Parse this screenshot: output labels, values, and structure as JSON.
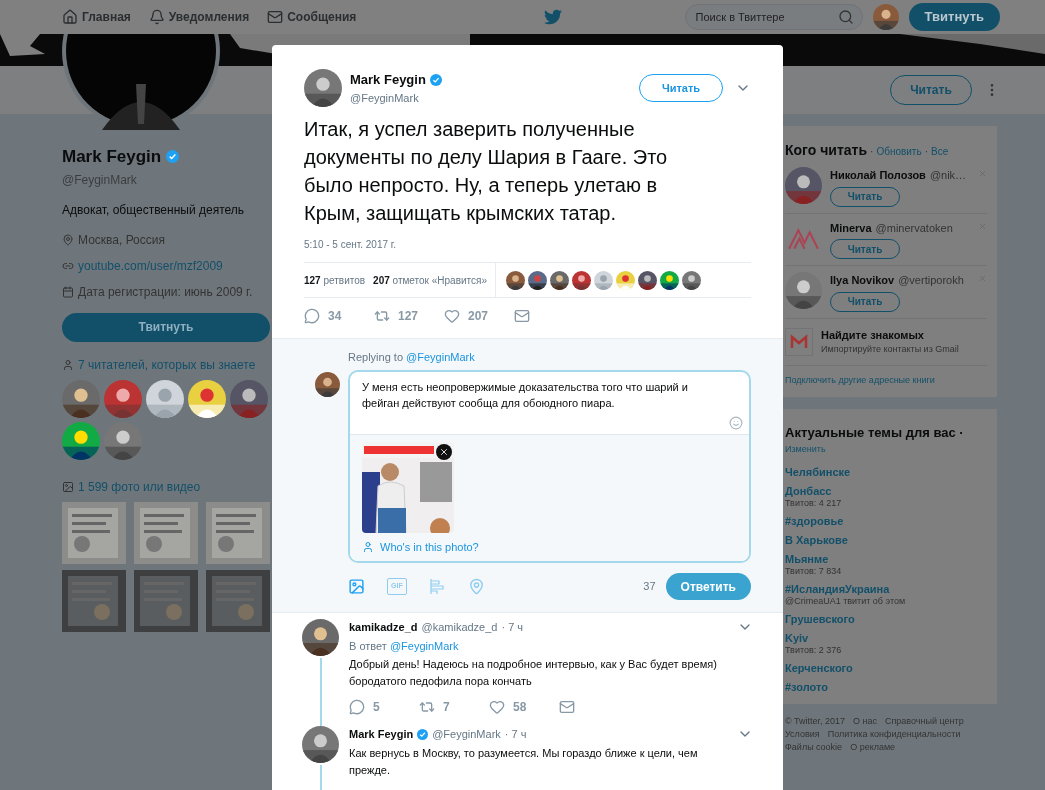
{
  "nav": {
    "items": [
      {
        "label": "Главная"
      },
      {
        "label": "Уведомления"
      },
      {
        "label": "Сообщения"
      }
    ],
    "search": {
      "placeholder": "Поиск в Твиттере"
    },
    "tweet_button": "Твитнуть"
  },
  "profile_bar": {
    "follow_button": "Читать"
  },
  "profile": {
    "name": "Mark Feygin",
    "verified": true,
    "handle": "@FeyginMark",
    "bio": "Адвокат, общественный деятель",
    "location": "Москва, Россия",
    "link": "youtube.com/user/mzf2009",
    "joined": "Дата регистрации: июнь 2009 г.",
    "tweet_button": "Твитнуть",
    "followers_known": "7 читателей, которых вы знаете",
    "media_label": "1 599 фото или видео"
  },
  "modal": {
    "author": {
      "name": "Mark Feygin",
      "verified": true,
      "handle": "@FeyginMark"
    },
    "follow_button": "Читать",
    "text": "Итак, я успел заверить полученные документы по делу Шария в Гааге. Это было непросто. Ну, а теперь улетаю в Крым, защищать крымских татар.",
    "time": "5:10 - 5 сент. 2017 г.",
    "stats": [
      "**127** ретвитов",
      "**207** отметок «Нравится»"
    ],
    "actions": {
      "replies": "34",
      "retweets": "127",
      "likes": "207"
    },
    "composer": {
      "replying_prefix": "Replying to",
      "replying_handle": "@FeyginMark",
      "value": "У меня есть неопровержимые доказательства того что шарий и фейган действуют сообща для обоюдного пиара.",
      "tag_link": "Who's in this photo?",
      "gif_label": "GIF",
      "counter": "37",
      "submit": "Ответить"
    },
    "replies": [
      {
        "name": "kamikadze_d",
        "verified": false,
        "handle": "@kamikadze_d",
        "time": "· 7 ч",
        "reply_prefix": "В ответ",
        "reply_handle": "@FeyginMark",
        "text": "Добрый день! Надеюсь на подробное интервью, как у Вас будет время)\nбородатого педофила пора кончать",
        "actions": {
          "replies": "5",
          "retweets": "7",
          "likes": "58"
        }
      },
      {
        "name": "Mark Feygin",
        "verified": true,
        "handle": "@FeyginMark",
        "time": "· 7 ч",
        "text": "Как вернусь в Москву, то разумеется. Мы гораздо ближе к цели, чем прежде."
      }
    ]
  },
  "who_to_follow": {
    "title": "Кого читать",
    "separator": "·",
    "links": [
      "Обновить",
      "Все"
    ],
    "suggestions": [
      {
        "name": "Николай Полозов",
        "handle": "@nik…",
        "button": "Читать",
        "kind": "person"
      },
      {
        "name": "Minerva",
        "handle": "@minervatoken",
        "button": "Читать",
        "kind": "logo"
      },
      {
        "name": "Ilya Novikov",
        "handle": "@vertiporokh",
        "button": "Читать",
        "kind": "person"
      }
    ],
    "find_friends": {
      "title": "Найдите знакомых",
      "subtitle": "Импортируйте контакты из Gmail"
    },
    "connect_link": "Подключить другие адресные книги"
  },
  "trends": {
    "title": "Актуальные темы для вас ·",
    "change_link": "Изменить",
    "items": [
      {
        "name": "Челябинске"
      },
      {
        "name": "Донбасс",
        "meta": "Твитов: 4 217"
      },
      {
        "name": "#здоровье"
      },
      {
        "name": "В Харькове"
      },
      {
        "name": "Мьянме",
        "meta": "Твитов: 7 834"
      },
      {
        "name": "#ИсландияУкраина",
        "meta": "@CrimeaUA1 твитит об этом"
      },
      {
        "name": "Грушевского"
      },
      {
        "name": "Kyiv",
        "meta": "Твитов: 2 376"
      },
      {
        "name": "Керченского"
      },
      {
        "name": "#золото"
      }
    ]
  },
  "footer": [
    "© Twitter, 2017",
    "О нас",
    "Справочный центр",
    "Условия",
    "Политика конфиденциальности",
    "Файлы cookie",
    "О рекламе"
  ]
}
